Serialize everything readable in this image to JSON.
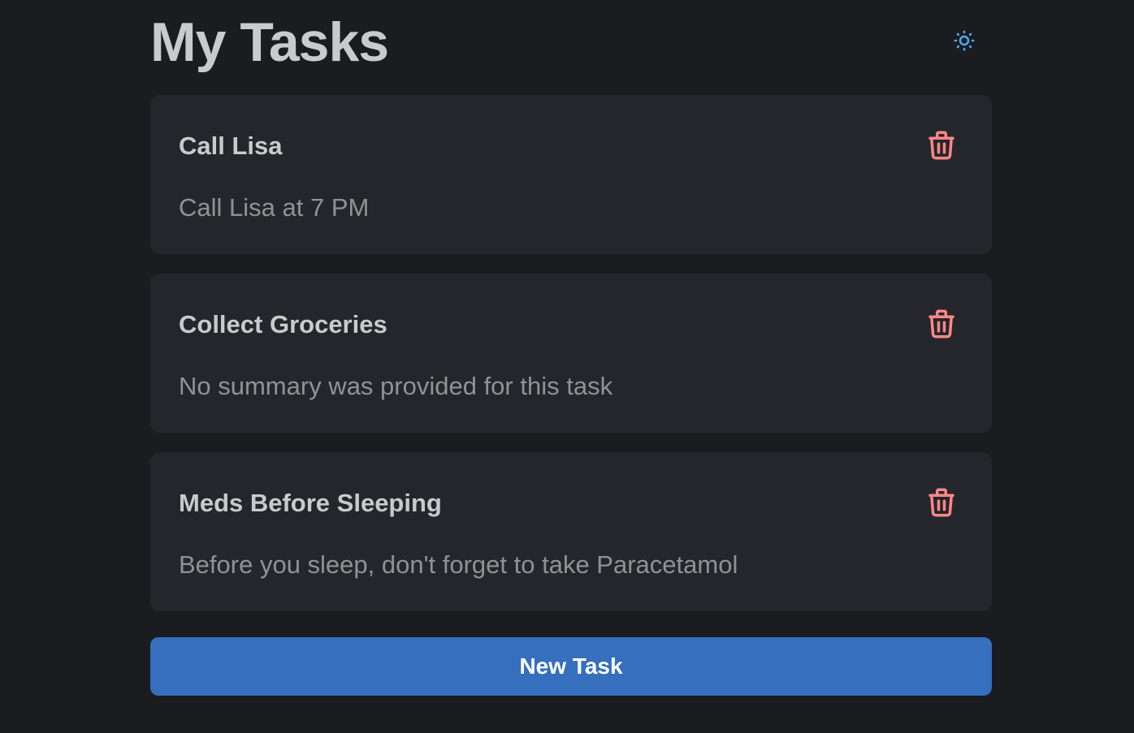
{
  "header": {
    "title": "My Tasks",
    "theme_toggle_icon": "sun-icon",
    "accent_color": "#4dabf7"
  },
  "tasks": [
    {
      "title": "Call Lisa",
      "summary": "Call Lisa at 7 PM",
      "delete_icon": "trash-icon"
    },
    {
      "title": "Collect Groceries",
      "summary": "No summary was provided for this task",
      "delete_icon": "trash-icon"
    },
    {
      "title": "Meds Before Sleeping",
      "summary": "Before you sleep, don't forget to take Paracetamol",
      "delete_icon": "trash-icon"
    }
  ],
  "actions": {
    "new_task_label": "New Task",
    "button_color": "#356fbe"
  },
  "colors": {
    "background": "#1b1c20",
    "card": "#25262b",
    "delete": "#ff8787"
  }
}
